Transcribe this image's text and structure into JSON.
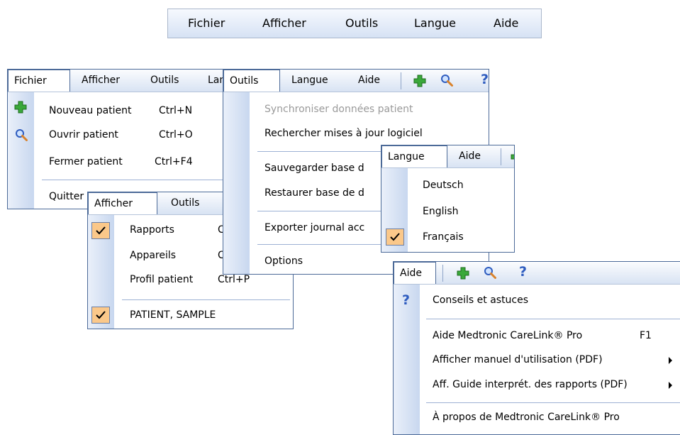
{
  "top_menu": [
    "Fichier",
    "Afficher",
    "Outils",
    "Langue",
    "Aide"
  ],
  "fichier_menu": {
    "bar": [
      "Fichier",
      "Afficher",
      "Outils",
      "Lan"
    ],
    "items": [
      {
        "label": "Nouveau patient",
        "shortcut": "Ctrl+N",
        "icon": "plus-icon"
      },
      {
        "label": "Ouvrir patient",
        "shortcut": "Ctrl+O",
        "icon": "magnifier-icon"
      },
      {
        "label": "Fermer patient",
        "shortcut": "Ctrl+F4"
      },
      {
        "label": "Quitter"
      }
    ]
  },
  "afficher_menu": {
    "bar": [
      "Afficher",
      "Outils"
    ],
    "items": [
      {
        "label": "Rapports",
        "shortcut": "C",
        "checked": true
      },
      {
        "label": "Appareils",
        "shortcut": "C"
      },
      {
        "label": "Profil patient",
        "shortcut": "Ctrl+P"
      },
      {
        "label": "PATIENT, SAMPLE",
        "checked": true
      }
    ]
  },
  "outils_menu": {
    "bar": [
      "Outils",
      "Langue",
      "Aide"
    ],
    "items": [
      {
        "label": "Synchroniser données patient",
        "disabled": true
      },
      {
        "label": "Rechercher mises à jour logiciel"
      },
      {
        "label": "Sauvegarder base d"
      },
      {
        "label": "Restaurer base de d"
      },
      {
        "label": "Exporter journal acc"
      },
      {
        "label": "Options"
      }
    ]
  },
  "langue_menu": {
    "bar": [
      "Langue",
      "Aide"
    ],
    "items": [
      {
        "label": "Deutsch"
      },
      {
        "label": "English"
      },
      {
        "label": "Français",
        "checked": true
      }
    ]
  },
  "aide_menu": {
    "bar": [
      "Aide"
    ],
    "items": [
      {
        "label": "Conseils et astuces",
        "icon": "question-icon"
      },
      {
        "label": "Aide Medtronic CareLink® Pro",
        "shortcut": "F1"
      },
      {
        "label": "Afficher manuel d'utilisation (PDF)",
        "submenu": true
      },
      {
        "label": "Aff. Guide interprét. des rapports (PDF)",
        "submenu": true
      },
      {
        "label": "À propos de Medtronic CareLink® Pro"
      }
    ]
  },
  "colors": {
    "check_bg": "#fbc88a",
    "menu_border": "#4c6a98",
    "gutter": "#c8d7ef",
    "plus_green": "#3aa83a",
    "question_blue": "#2e5cbf"
  }
}
